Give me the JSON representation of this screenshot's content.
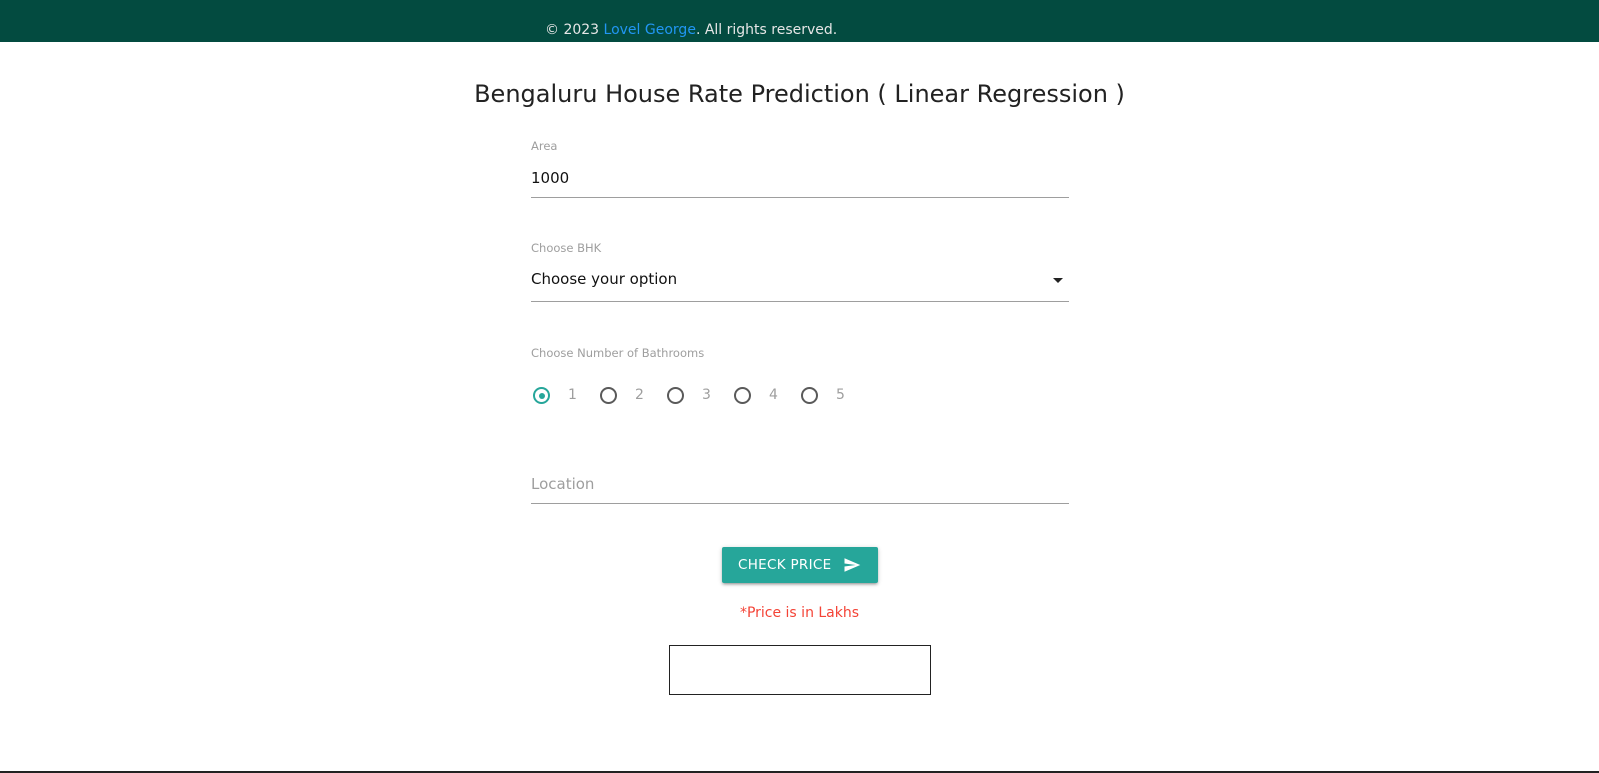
{
  "footer": {
    "prefix": "© 2023 ",
    "author_link": "Lovel George",
    "suffix": ". All rights reserved."
  },
  "page": {
    "title": "Bengaluru House Rate Prediction ( Linear Regression )"
  },
  "form": {
    "area": {
      "label": "Area",
      "value": "1000"
    },
    "bhk": {
      "label": "Choose BHK",
      "selected": "Choose your option"
    },
    "bathrooms": {
      "label": "Choose Number of Bathrooms",
      "options": [
        "1",
        "2",
        "3",
        "4",
        "5"
      ],
      "selected": "1"
    },
    "location": {
      "placeholder": "Location",
      "value": ""
    },
    "submit": {
      "label": "CHECK PRICE",
      "icon": "send-icon"
    },
    "note": "*Price is in Lakhs",
    "result": ""
  },
  "colors": {
    "header_bg": "#034b40",
    "accent": "#26a69a",
    "link": "#2196f3",
    "note": "#f44336"
  }
}
